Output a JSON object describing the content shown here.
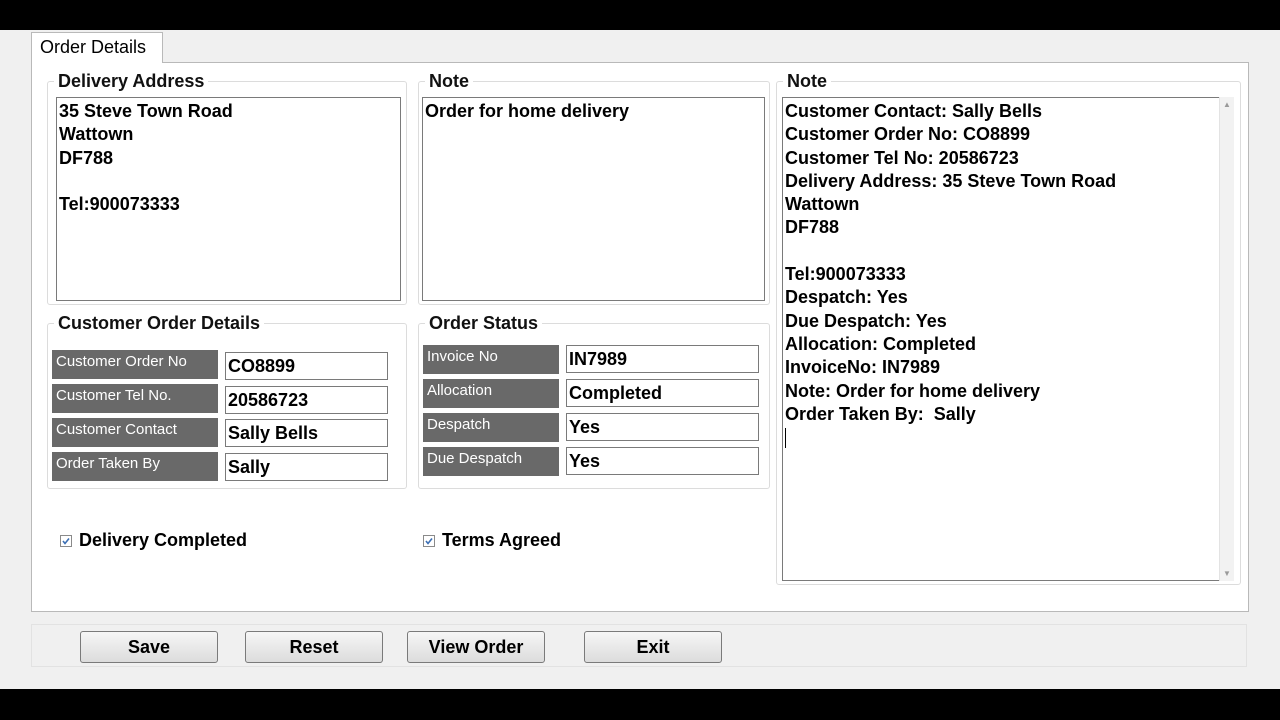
{
  "tab": {
    "label": "Order Details"
  },
  "delivery_address": {
    "title": "Delivery Address",
    "text": "35 Steve Town Road\nWattown\nDF788\n\nTel:900073333"
  },
  "note_small": {
    "title": "Note",
    "text": "Order for home delivery"
  },
  "note_large": {
    "title": "Note",
    "text": "Customer Contact: Sally Bells\nCustomer Order No: CO8899\nCustomer Tel No: 20586723\nDelivery Address: 35 Steve Town Road\nWattown\nDF788\n\nTel:900073333\nDespatch: Yes\nDue Despatch: Yes\nAllocation: Completed\nInvoiceNo: IN7989\nNote: Order for home delivery\nOrder Taken By:  Sally"
  },
  "customer_order_details": {
    "title": "Customer Order Details",
    "fields": [
      {
        "label": "Customer Order No",
        "value": "CO8899"
      },
      {
        "label": "Customer Tel No.",
        "value": "20586723"
      },
      {
        "label": "Customer Contact",
        "value": "Sally Bells"
      },
      {
        "label": "Order Taken By",
        "value": "Sally"
      }
    ]
  },
  "order_status": {
    "title": "Order Status",
    "fields": [
      {
        "label": "Invoice No",
        "value": "IN7989"
      },
      {
        "label": "Allocation",
        "value": "Completed"
      },
      {
        "label": "Despatch",
        "value": "Yes"
      },
      {
        "label": "Due Despatch",
        "value": "Yes"
      }
    ]
  },
  "checkboxes": {
    "delivery_completed": {
      "label": "Delivery Completed",
      "checked": true
    },
    "terms_agreed": {
      "label": "Terms Agreed",
      "checked": true
    }
  },
  "buttons": {
    "save": "Save",
    "reset": "Reset",
    "view_order": "View Order",
    "exit": "Exit"
  },
  "icons": {
    "check": "check-icon",
    "scroll_up": "scroll-up-arrow-icon",
    "scroll_down": "scroll-down-arrow-icon"
  }
}
